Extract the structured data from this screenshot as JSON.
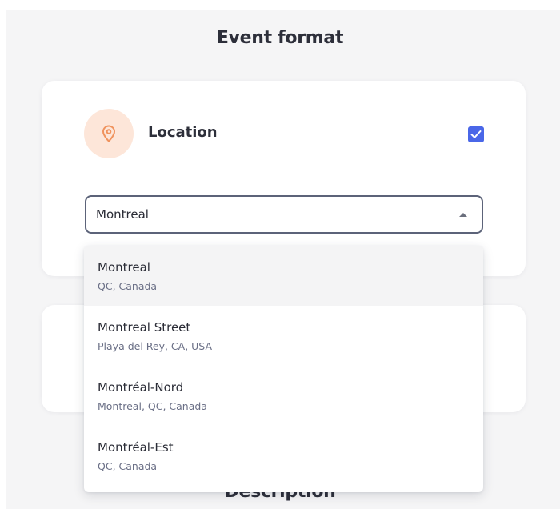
{
  "event_format": {
    "title": "Event format"
  },
  "location_card": {
    "label": "Location",
    "icon": "map-pin-icon",
    "checked": true,
    "icon_bg_color": "#fde6d9",
    "icon_color": "#f0935e",
    "checkbox_color": "#4a67e8"
  },
  "location_select": {
    "value": "Montreal",
    "expanded": true
  },
  "suggestions": [
    {
      "name": "Montreal",
      "detail": "QC, Canada",
      "highlighted": true
    },
    {
      "name": "Montreal Street",
      "detail": "Playa del Rey, CA, USA",
      "highlighted": false
    },
    {
      "name": "Montréal-Nord",
      "detail": "Montreal, QC, Canada",
      "highlighted": false
    },
    {
      "name": "Montréal-Est",
      "detail": "QC, Canada",
      "highlighted": false
    }
  ],
  "description": {
    "title": "Description"
  }
}
